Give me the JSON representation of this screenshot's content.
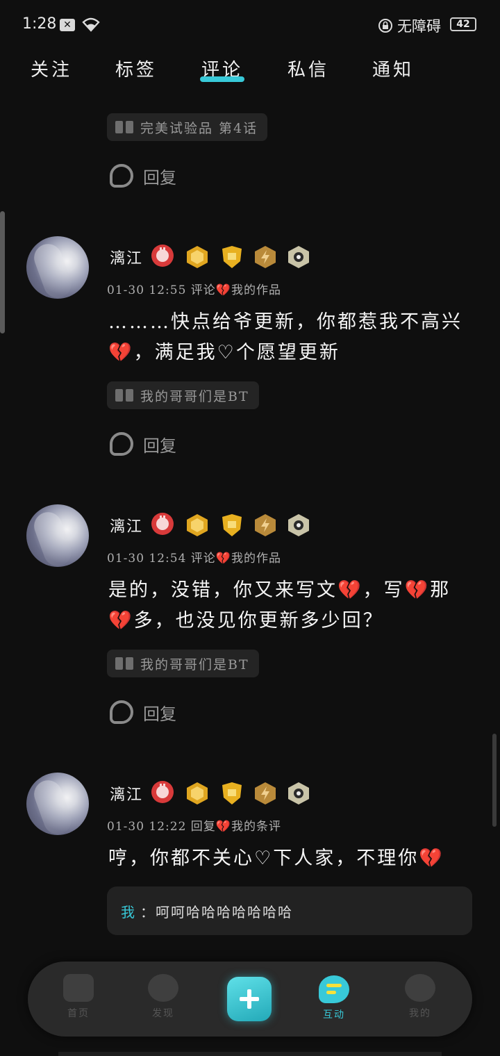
{
  "status": {
    "time": "1:28",
    "accessibility": "无障碍",
    "battery": "42"
  },
  "tabs": [
    "关注",
    "标签",
    "评论",
    "私信",
    "通知"
  ],
  "active_tab": "评论",
  "accent_color": "#38c9d8",
  "top_item": {
    "work_tag": "完美试验品 第4话",
    "reply_label": "回复"
  },
  "comments": [
    {
      "user": "漓江",
      "meta": "01-30 12:55  评论💔我的作品",
      "text": "………快点给爷更新，你都惹我不高兴💔，满足我♡个愿望更新",
      "work_tag": "我的哥哥们是BT",
      "reply_label": "回复"
    },
    {
      "user": "漓江",
      "meta": "01-30 12:54  评论💔我的作品",
      "text": "是的，没错，你又来写文💔，写💔那💔多，也没见你更新多少回？",
      "work_tag": "我的哥哥们是BT",
      "reply_label": "回复"
    },
    {
      "user": "漓江",
      "meta": "01-30 12:22  回复💔我的条评",
      "text": "哼，你都不关心♡下人家，不理你💔",
      "quote_author": "我",
      "quote_sep": "：",
      "quote_text": "呵呵哈哈哈哈哈哈哈"
    }
  ],
  "nav": {
    "home": "首页",
    "discover": "发现",
    "interact": "互动",
    "mine": "我的"
  },
  "badges": [
    "rabbit-badge",
    "crown-badge",
    "shield-badge",
    "lightning-badge",
    "eye-badge"
  ]
}
